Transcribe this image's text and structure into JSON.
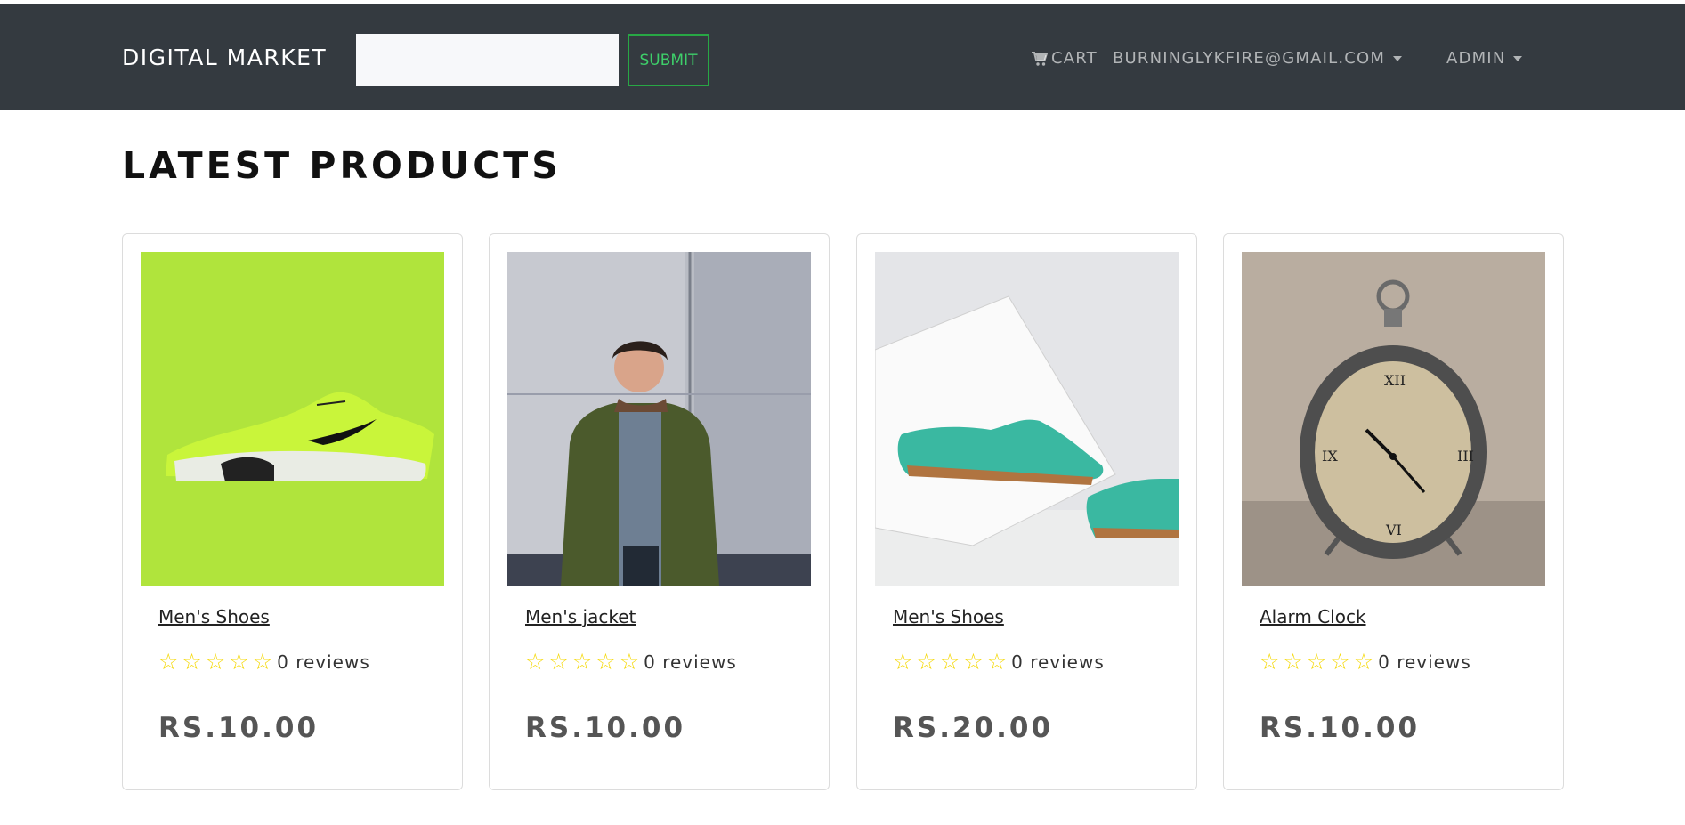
{
  "header": {
    "brand": "DIGITAL MARKET",
    "search_placeholder": "",
    "submit_label": "SUBMIT",
    "cart_label": "CART",
    "user_label": "BURNINGLYKFIRE@GMAIL.COM",
    "admin_label": "ADMIN"
  },
  "main": {
    "title": "LATEST PRODUCTS",
    "products": [
      {
        "name": "Men's Shoes",
        "rating": 0,
        "reviews": "0 reviews",
        "price": "RS.10.00"
      },
      {
        "name": "Men's jacket",
        "rating": 0,
        "reviews": "0 reviews",
        "price": "RS.10.00"
      },
      {
        "name": "Men's Shoes",
        "rating": 0,
        "reviews": "0 reviews",
        "price": "RS.20.00"
      },
      {
        "name": "Alarm Clock",
        "rating": 0,
        "reviews": "0 reviews",
        "price": "RS.10.00"
      }
    ]
  },
  "icons": {
    "cart": "cart-icon",
    "star": "star-outline-icon",
    "dropdown": "caret-down-icon"
  },
  "colors": {
    "navbar_bg": "#343a40",
    "submit_border": "#28a745",
    "star": "#f5d90a"
  }
}
